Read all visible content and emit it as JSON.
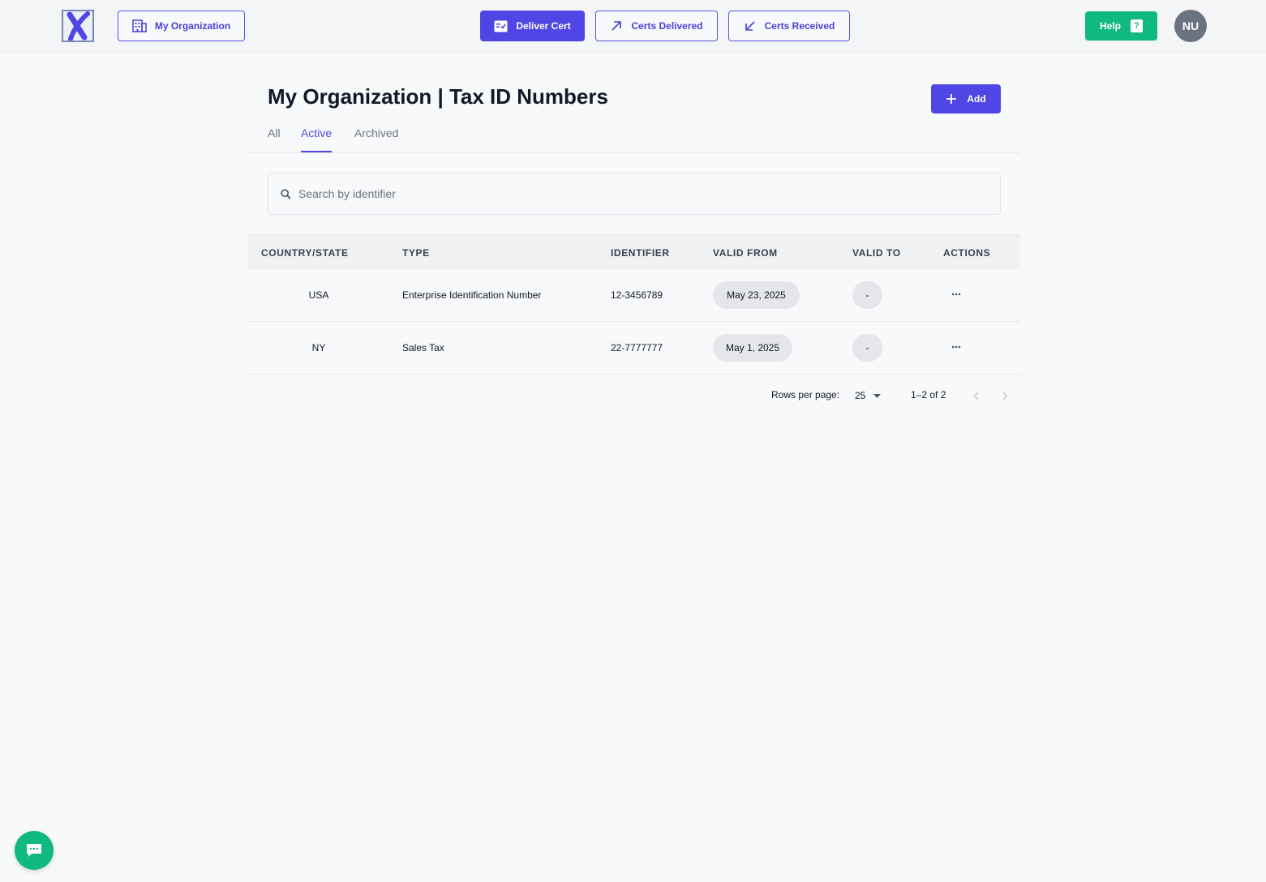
{
  "nav": {
    "org_label": "My Organization",
    "deliver_label": "Deliver Cert",
    "delivered_label": "Certs Delivered",
    "received_label": "Certs Received",
    "help_label": "Help",
    "help_glyph": "?",
    "avatar_initials": "NU"
  },
  "page": {
    "title": "My Organization | Tax ID Numbers",
    "add_label": "Add"
  },
  "tabs": [
    {
      "label": "All"
    },
    {
      "label": "Active",
      "active": true
    },
    {
      "label": "Archived"
    }
  ],
  "search": {
    "placeholder": "Search by identifier",
    "value": ""
  },
  "table": {
    "columns": [
      "COUNTRY/STATE",
      "TYPE",
      "IDENTIFIER",
      "VALID FROM",
      "VALID TO",
      "ACTIONS"
    ],
    "rows": [
      {
        "country": "USA",
        "type": "Enterprise Identification Number",
        "identifier": "12-3456789",
        "valid_from": "May 23, 2025",
        "valid_to": "-"
      },
      {
        "country": "NY",
        "type": "Sales Tax",
        "identifier": "22-7777777",
        "valid_from": "May 1, 2025",
        "valid_to": "-"
      }
    ]
  },
  "pagination": {
    "rows_per_page_label": "Rows per page:",
    "rows_per_page": "25",
    "range": "1–2 of 2"
  },
  "colors": {
    "primary": "#4f46e5",
    "success": "#10b981",
    "avatar": "#6b7280"
  }
}
